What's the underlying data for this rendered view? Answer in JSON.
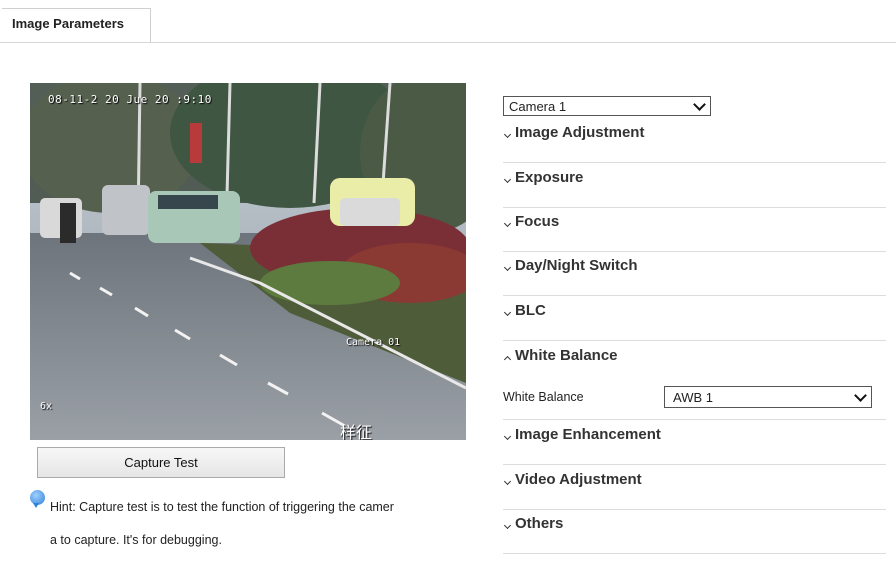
{
  "tab": {
    "label": "Image Parameters"
  },
  "preview": {
    "osd_date": "08-11-2 20 Jue 20 :9:10",
    "osd_camera": "Camera 01",
    "osd_zoom": "6x",
    "osd_tag": "样征"
  },
  "capture": {
    "button_label": "Capture Test",
    "hint_line1": "Hint: Capture test is to test the function of triggering the camer",
    "hint_line2": "a to capture. It's for debugging."
  },
  "camera_select": {
    "value": "Camera 1"
  },
  "sections": [
    {
      "label": "Image Adjustment",
      "expanded": false
    },
    {
      "label": "Exposure",
      "expanded": false
    },
    {
      "label": "Focus",
      "expanded": false
    },
    {
      "label": "Day/Night Switch",
      "expanded": false
    },
    {
      "label": "BLC",
      "expanded": false
    },
    {
      "label": "White Balance",
      "expanded": true
    },
    {
      "label": "Image Enhancement",
      "expanded": false
    },
    {
      "label": "Video Adjustment",
      "expanded": false
    },
    {
      "label": "Others",
      "expanded": false
    }
  ],
  "white_balance": {
    "field_label": "White Balance",
    "value": "AWB 1"
  },
  "colors": {
    "hint_icon": "#2f80d8",
    "divider": "#dddddd"
  }
}
